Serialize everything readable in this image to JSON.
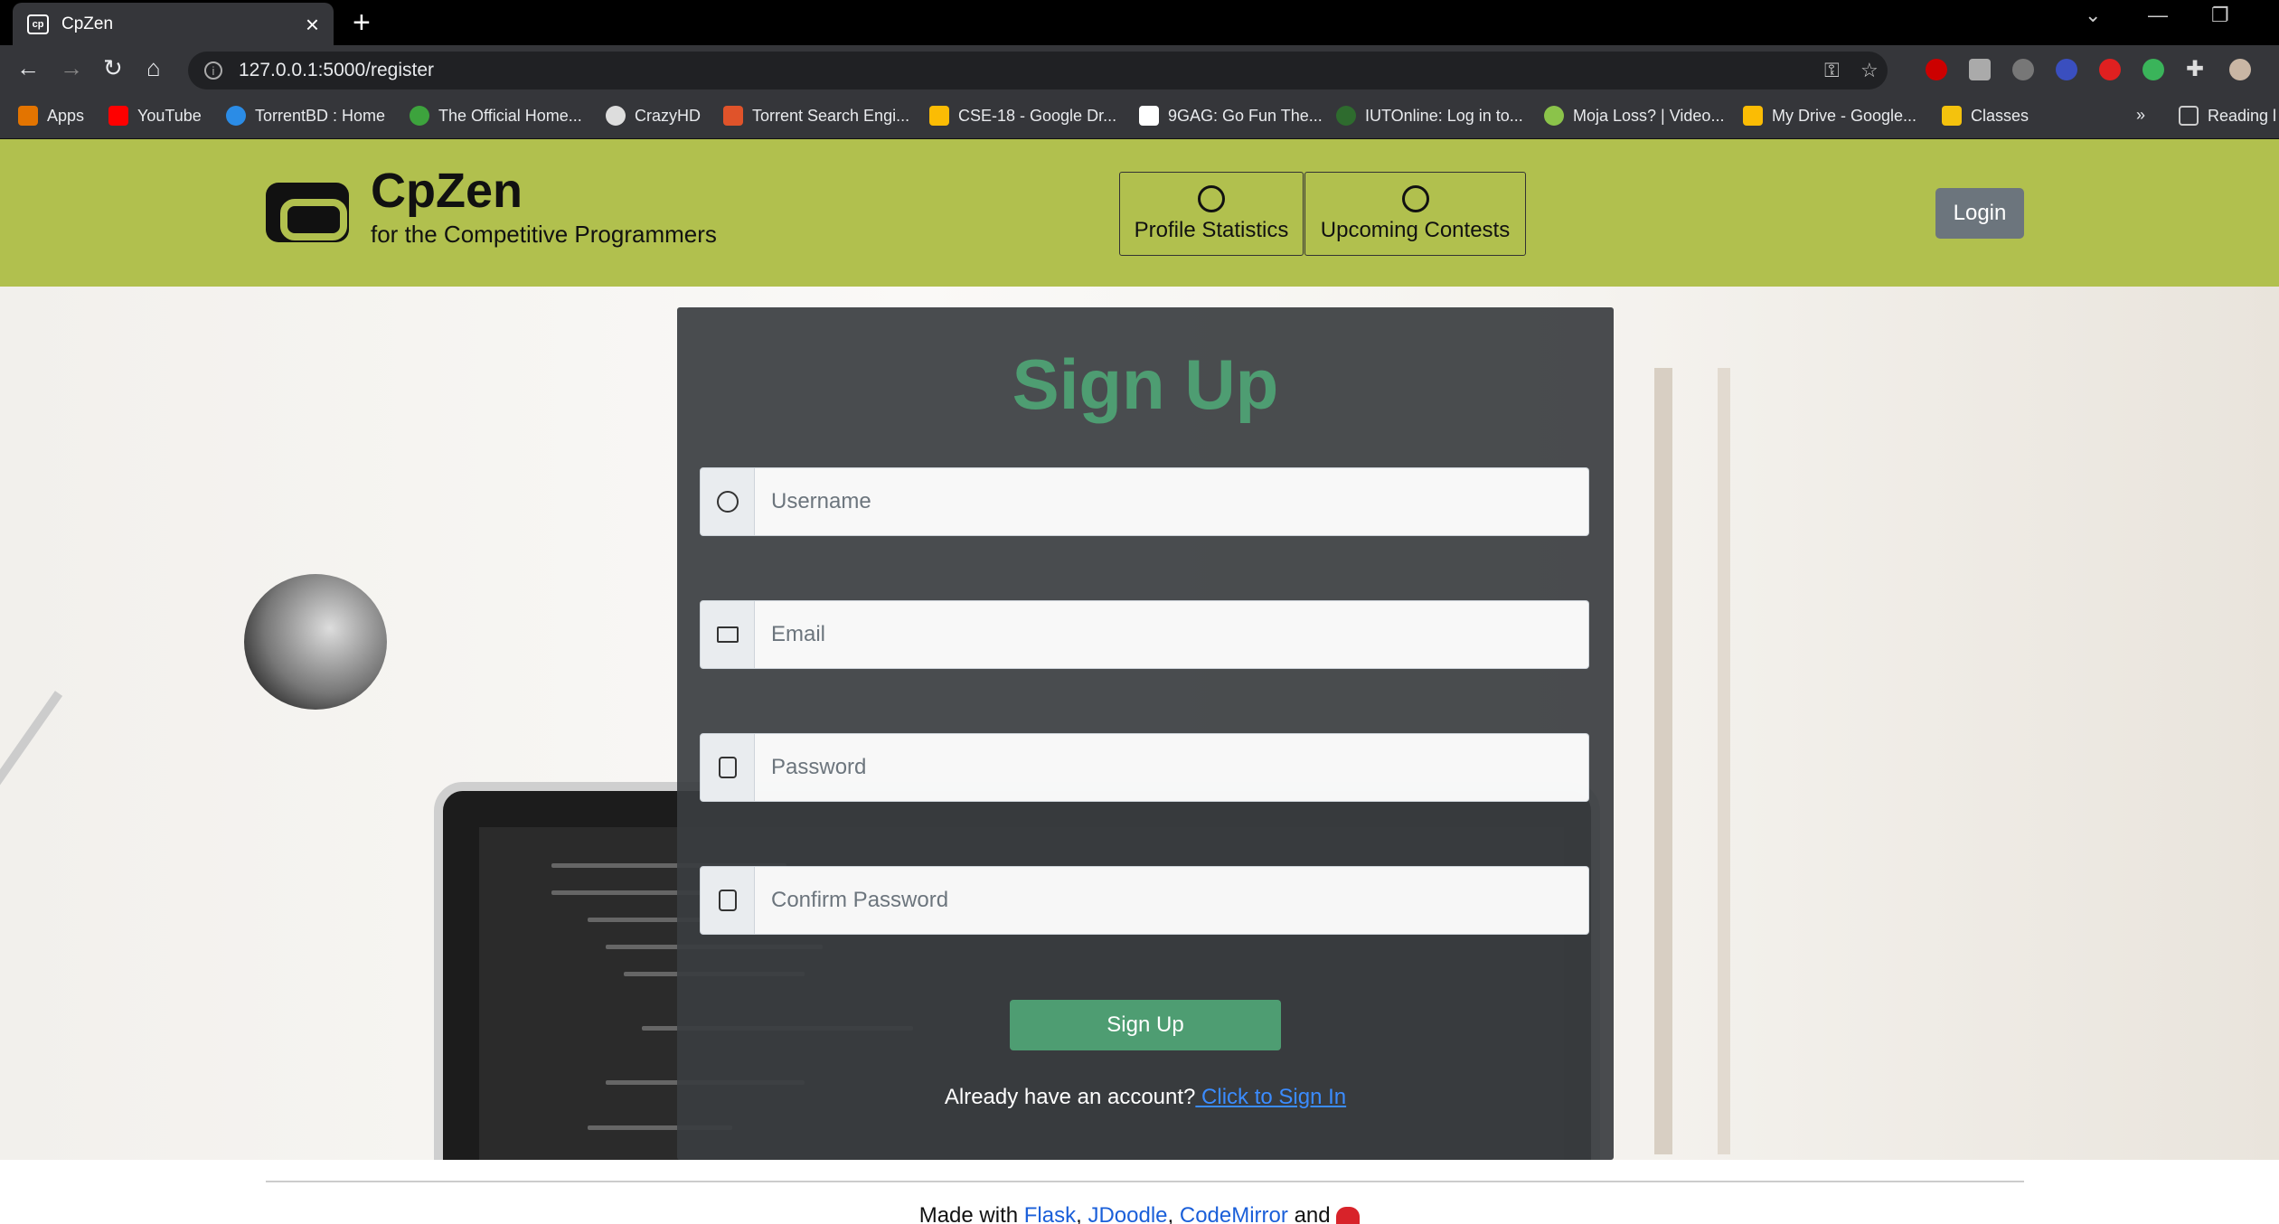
{
  "browser": {
    "tab_title": "CpZen",
    "tab_favicon": "cp",
    "url": "127.0.0.1:5000/register",
    "bookmarks": [
      {
        "label": "Apps",
        "icon": "apps-grid-icon",
        "color": "#e37400"
      },
      {
        "label": "YouTube",
        "icon": "youtube-icon",
        "color": "#ff0000"
      },
      {
        "label": "TorrentBD : Home",
        "icon": "torrentbd-icon",
        "color": "#2b8ce6"
      },
      {
        "label": "The Official Home...",
        "icon": "official-home-icon",
        "color": "#3da33d"
      },
      {
        "label": "CrazyHD",
        "icon": "crazyhd-icon",
        "color": "#dddddd"
      },
      {
        "label": "Torrent Search Engi...",
        "icon": "torrent-search-icon",
        "color": "#e0532a"
      },
      {
        "label": "CSE-18 - Google Dr...",
        "icon": "google-drive-icon",
        "color": "#fbbc04"
      },
      {
        "label": "9GAG: Go Fun The...",
        "icon": "9gag-icon",
        "color": "#ffffff"
      },
      {
        "label": "IUTOnline: Log in to...",
        "icon": "iutonline-icon",
        "color": "#2e6b2e"
      },
      {
        "label": "Moja Loss? | Video...",
        "icon": "moja-loss-icon",
        "color": "#8bc34a"
      },
      {
        "label": "My Drive - Google...",
        "icon": "google-drive-icon",
        "color": "#fbbc04"
      },
      {
        "label": "Classes",
        "icon": "classroom-icon",
        "color": "#f4c20d"
      },
      {
        "label": "Reading l",
        "icon": "reading-list-icon",
        "color": "#cccccc"
      }
    ]
  },
  "header": {
    "brand_name": "CpZen",
    "tagline": "for the Competitive Programmers",
    "nav": [
      {
        "label": "Profile Statistics",
        "icon": "user-circle-icon"
      },
      {
        "label": "Upcoming Contests",
        "icon": "clock-icon"
      }
    ],
    "login_label": "Login",
    "bg_color": "#b1c04e"
  },
  "form": {
    "title": "Sign Up",
    "fields": [
      {
        "placeholder": "Username",
        "icon": "user-circle-icon"
      },
      {
        "placeholder": "Email",
        "icon": "envelope-icon"
      },
      {
        "placeholder": "Password",
        "icon": "lock-icon"
      },
      {
        "placeholder": "Confirm Password",
        "icon": "lock-icon"
      }
    ],
    "submit_label": "Sign Up",
    "already_text": "Already have an account?",
    "signin_link": " Click to Sign In",
    "accent_color": "#4e9d72"
  },
  "footer": {
    "made_with": "Made with",
    "links": [
      "Flask",
      "JDoodle",
      "CodeMirror"
    ],
    "and": "and",
    "heart_icon": "heart-icon"
  }
}
